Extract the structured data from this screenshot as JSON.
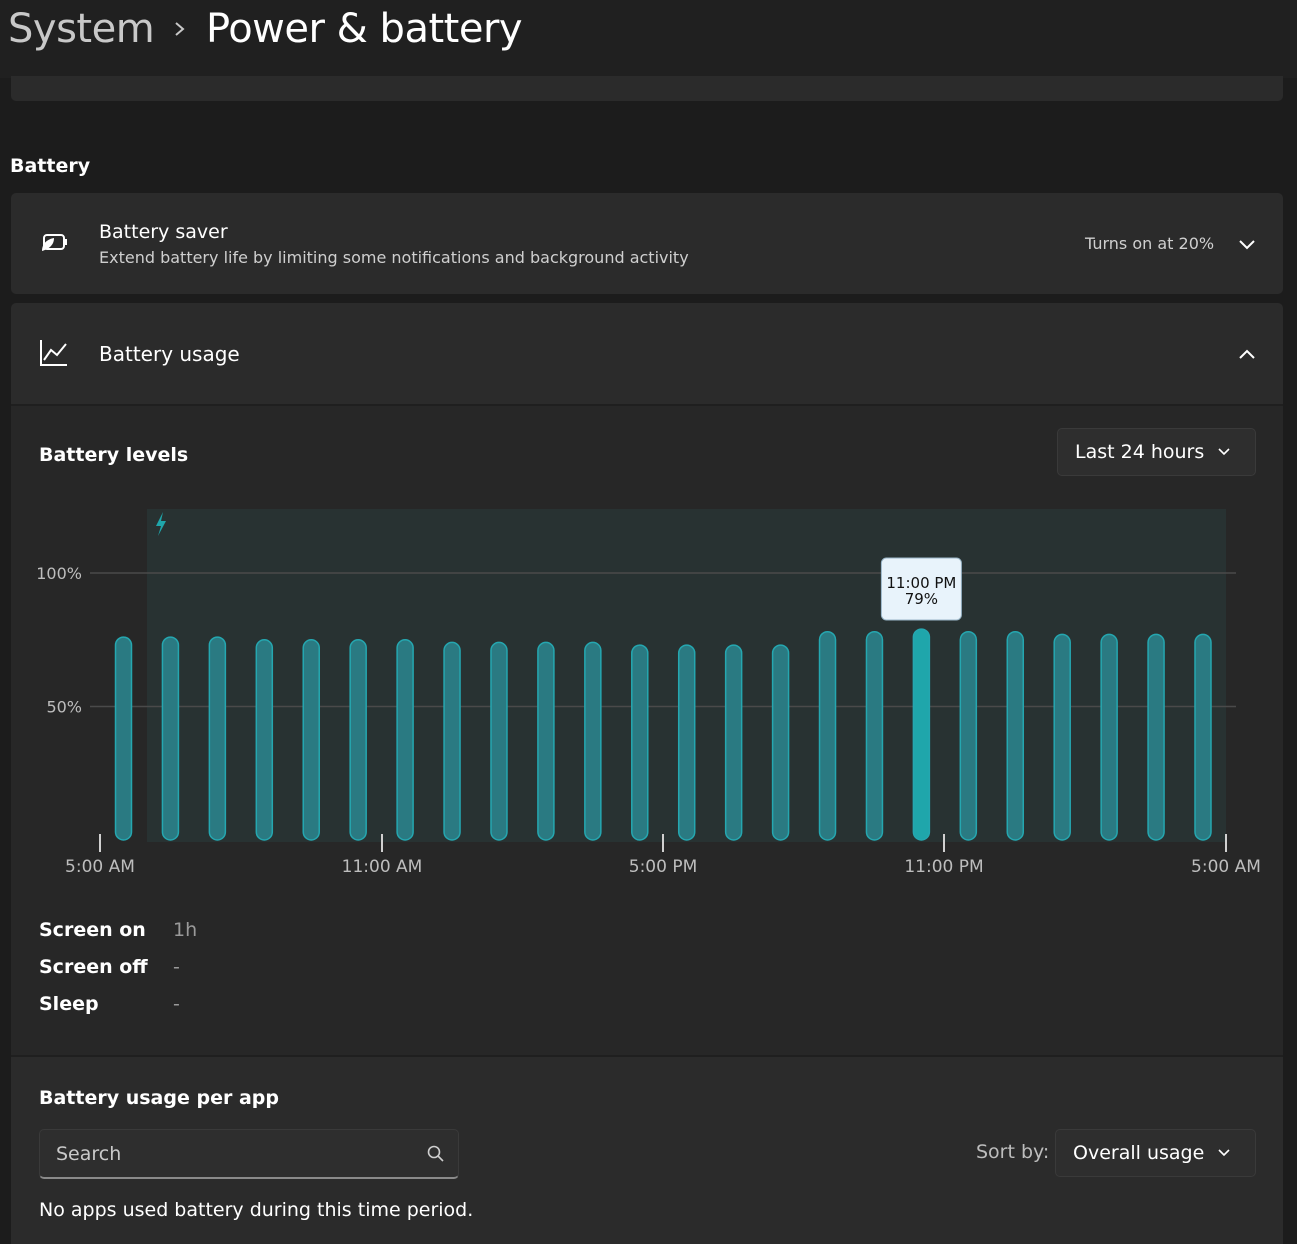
{
  "breadcrumb": {
    "root": "System",
    "page": "Power & battery"
  },
  "battery_section": {
    "title": "Battery"
  },
  "battery_saver": {
    "title": "Battery saver",
    "description": "Extend battery life by limiting some notifications and background activity",
    "status": "Turns on at 20%"
  },
  "battery_usage": {
    "title": "Battery usage",
    "levels_title": "Battery levels",
    "time_range": "Last 24 hours"
  },
  "chart_data": {
    "type": "bar",
    "y_ticks": [
      "100%",
      "50%"
    ],
    "x_ticks": [
      "5:00 AM",
      "11:00 AM",
      "5:00 PM",
      "11:00 PM",
      "5:00 AM"
    ],
    "ylim": [
      0,
      100
    ],
    "bar_values": [
      76,
      76,
      76,
      75,
      75,
      75,
      75,
      74,
      74,
      74,
      74,
      73,
      73,
      73,
      73,
      78,
      78,
      79,
      78,
      78,
      77,
      77,
      77,
      77
    ],
    "selected_index": 17,
    "charging_indicator": "lightning-icon",
    "tooltip": {
      "time": "11:00 PM",
      "value": "79%"
    },
    "colors": {
      "bar": "#2a7a82",
      "bar_selected": "#1fa6ab",
      "bar_stroke": "#25a7b0",
      "plot_bg": "#283232"
    }
  },
  "stats": [
    {
      "label": "Screen on",
      "value": "1h"
    },
    {
      "label": "Screen off",
      "value": "-"
    },
    {
      "label": "Sleep",
      "value": "-"
    }
  ],
  "per_app": {
    "title": "Battery usage per app",
    "search_placeholder": "Search",
    "sort_label": "Sort by:",
    "sort_value": "Overall usage",
    "empty_message": "No apps used battery during this time period."
  }
}
